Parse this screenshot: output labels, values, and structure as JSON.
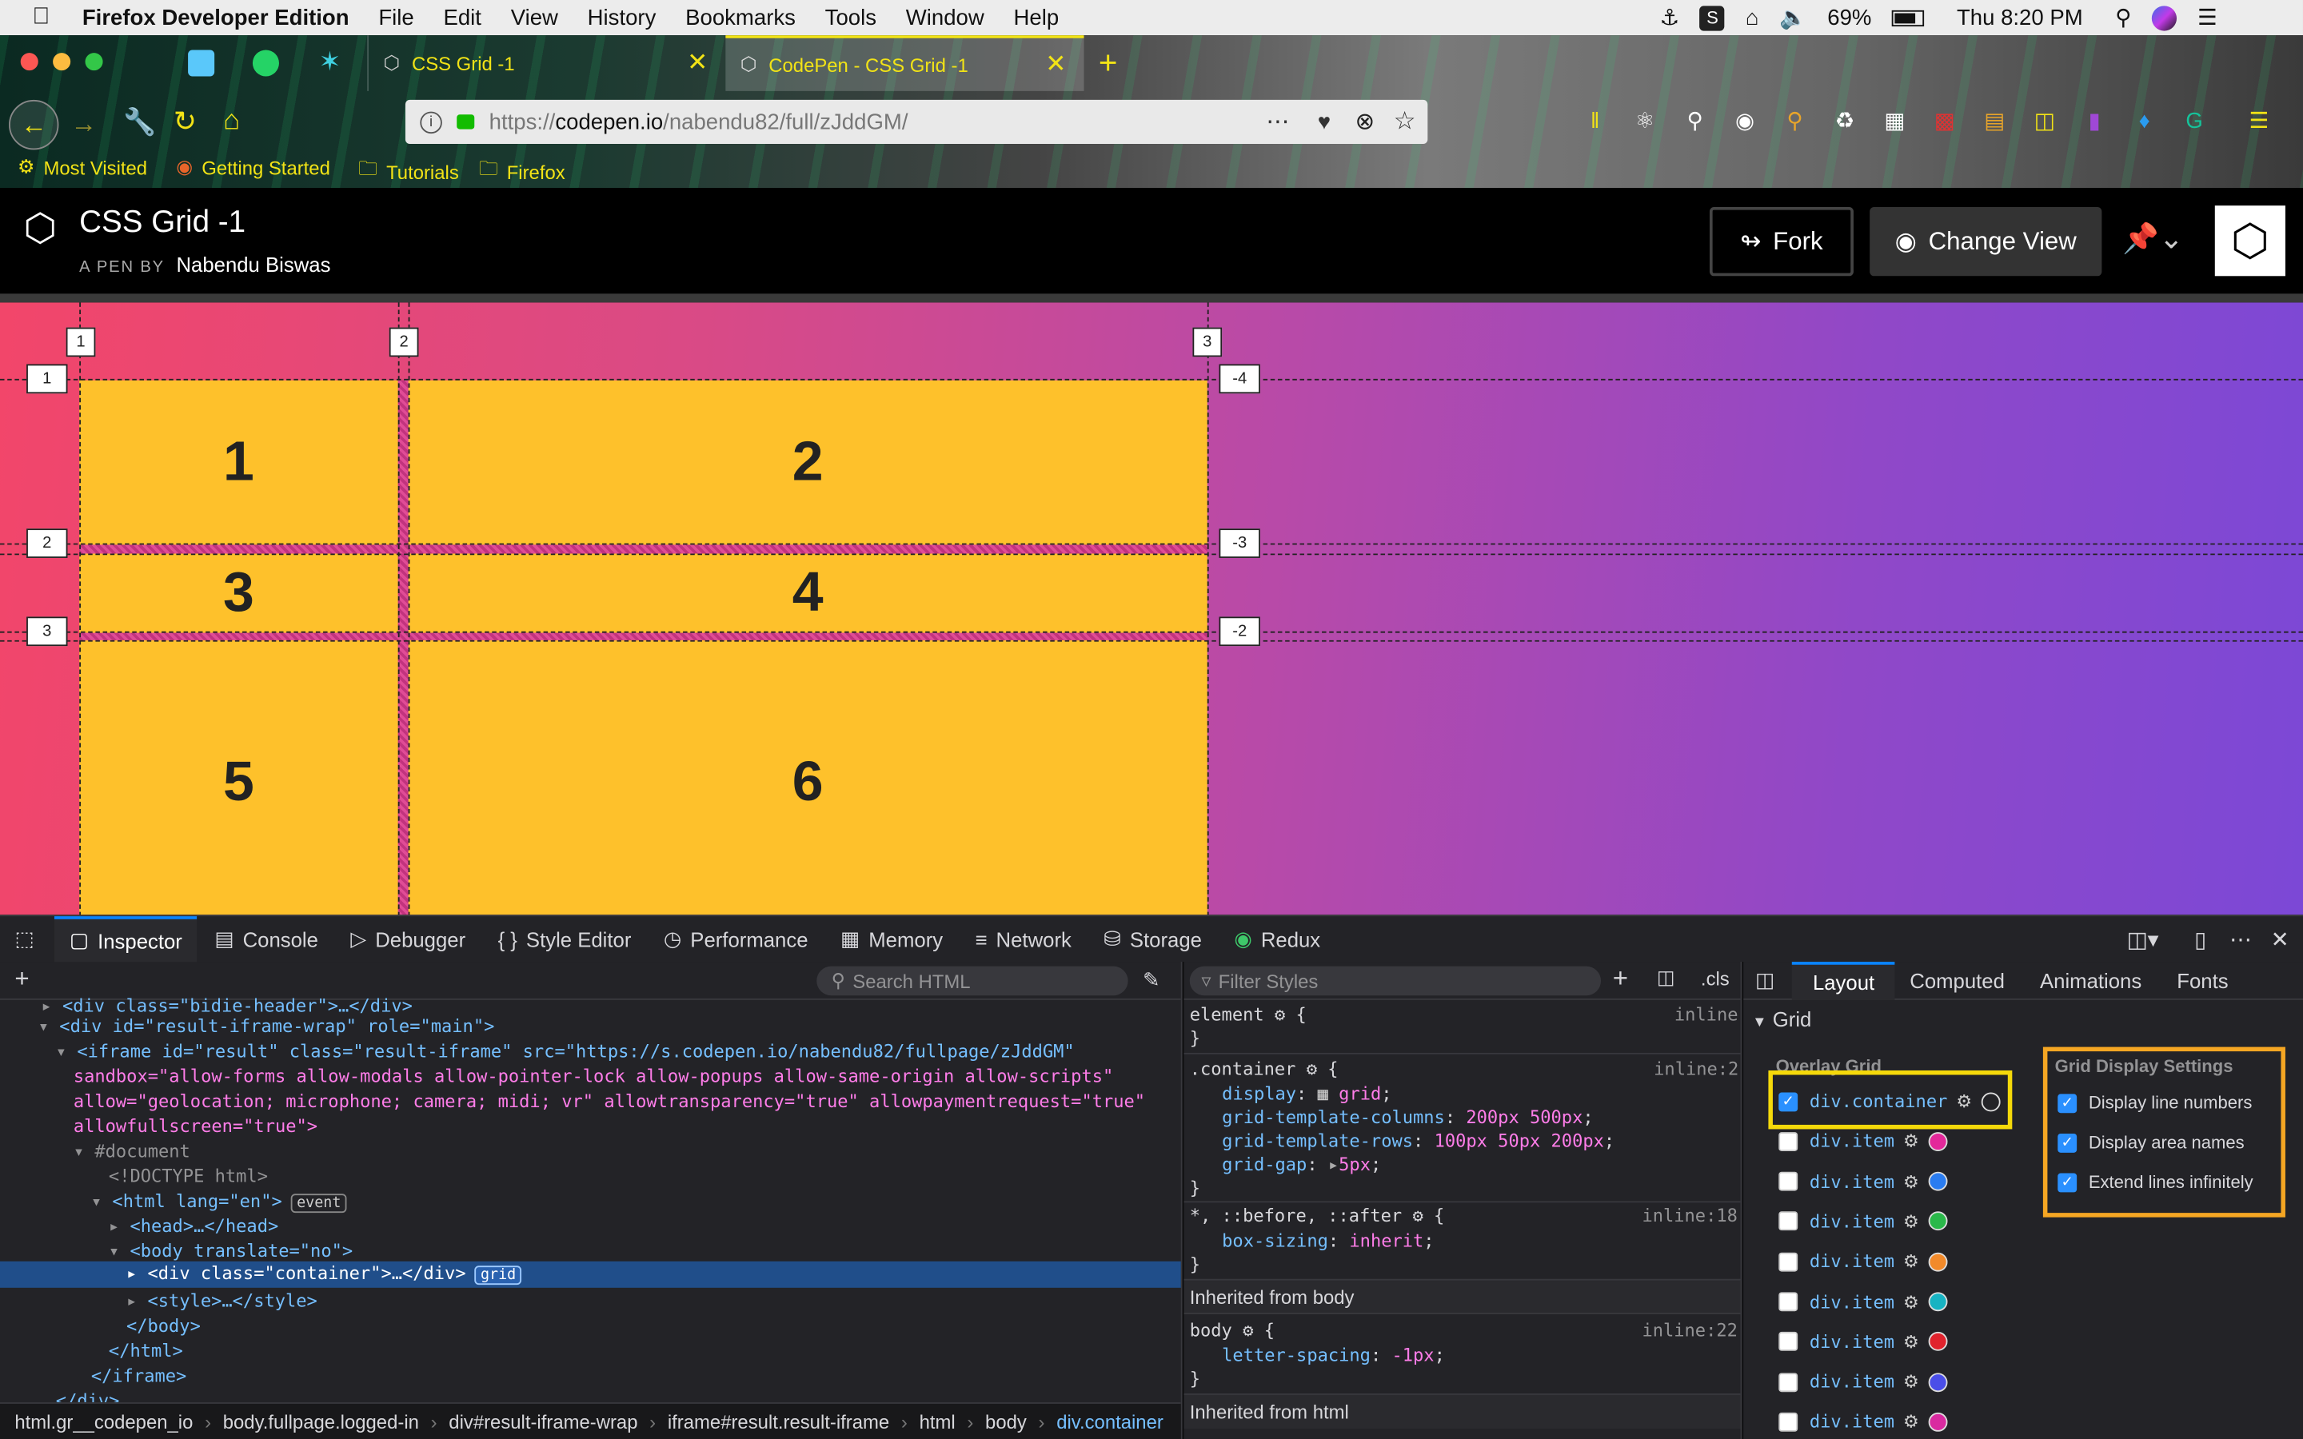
{
  "menubar": {
    "app": "Firefox Developer Edition",
    "items": [
      "File",
      "Edit",
      "View",
      "History",
      "Bookmarks",
      "Tools",
      "Window",
      "Help"
    ],
    "battery": "69%",
    "clock": "Thu 8:20 PM"
  },
  "tabs": [
    {
      "label": "CSS Grid -1"
    },
    {
      "label": "CodePen - CSS Grid -1"
    }
  ],
  "url": {
    "prefix": "https://",
    "host": "codepen.io",
    "path": "/nabendu82/full/zJddGM/"
  },
  "bookmarks": [
    "Most Visited",
    "Getting Started",
    "Tutorials",
    "Firefox"
  ],
  "codepen": {
    "title": "CSS Grid -1",
    "byline": "A PEN BY",
    "author": "Nabendu Biswas",
    "fork": "Fork",
    "change_view": "Change View"
  },
  "grid": {
    "col_lines": [
      "1",
      "2",
      "3"
    ],
    "row_lines_left": [
      "1",
      "2",
      "3"
    ],
    "row_lines_right": [
      "-4",
      "-3",
      "-2"
    ],
    "cells": [
      "1",
      "2",
      "3",
      "4",
      "5",
      "6"
    ]
  },
  "devtools": {
    "tabs": [
      "Inspector",
      "Console",
      "Debugger",
      "Style Editor",
      "Performance",
      "Memory",
      "Network",
      "Storage",
      "Redux"
    ],
    "search_html": "Search HTML",
    "filter_styles": "Filter Styles",
    "cls": ".cls",
    "side_tabs": [
      "Layout",
      "Computed",
      "Animations",
      "Fonts"
    ],
    "html_lines": [
      "<div class=\"bidie-header\">…</div>",
      "<div id=\"result-iframe-wrap\" role=\"main\">",
      "<iframe id=\"result\" class=\"result-iframe\" src=\"https://s.codepen.io/nabendu82/fullpage/zJddGM\"",
      "sandbox=\"allow-forms allow-modals allow-pointer-lock allow-popups allow-same-origin allow-scripts\"",
      "allow=\"geolocation; microphone; camera; midi; vr\" allowtransparency=\"true\" allowpaymentrequest=\"true\"",
      "allowfullscreen=\"true\">",
      "#document",
      "<!DOCTYPE html>",
      "<html lang=\"en\">",
      "<head>…</head>",
      "<body translate=\"no\">",
      "<div class=\"container\">…</div>",
      "<style>…</style>",
      "</body>",
      "</html>",
      "</iframe>",
      "</div>"
    ],
    "event_badge": "event",
    "grid_badge": "grid",
    "breadcrumbs": [
      "html.gr__codepen_io",
      "body.fullpage.logged-in",
      "div#result-iframe-wrap",
      "iframe#result.result-iframe",
      "html",
      "body",
      "div.container"
    ],
    "rules": [
      {
        "selector": "element",
        "source": "inline",
        "decls": []
      },
      {
        "selector": ".container",
        "source": "inline:2",
        "decls": [
          [
            "display",
            "grid"
          ],
          [
            "grid-template-columns",
            "200px 500px"
          ],
          [
            "grid-template-rows",
            "100px 50px 200px"
          ],
          [
            "grid-gap",
            "5px"
          ]
        ]
      },
      {
        "selector": "*, ::before, ::after",
        "source": "inline:18",
        "decls": [
          [
            "box-sizing",
            "inherit"
          ]
        ]
      },
      {
        "header": "Inherited from body"
      },
      {
        "selector": "body",
        "source": "inline:22",
        "decls": [
          [
            "letter-spacing",
            "-1px"
          ]
        ]
      },
      {
        "header": "Inherited from html"
      }
    ],
    "layout": {
      "section": "Grid",
      "overlay_title": "Overlay Grid",
      "overlays": [
        {
          "name": "div.container",
          "checked": true,
          "color": "#ffffff"
        },
        {
          "name": "div.item",
          "checked": false,
          "color": "#e3289a"
        },
        {
          "name": "div.item",
          "checked": false,
          "color": "#2a7cf0"
        },
        {
          "name": "div.item",
          "checked": false,
          "color": "#2ab84a"
        },
        {
          "name": "div.item",
          "checked": false,
          "color": "#f28a2a"
        },
        {
          "name": "div.item",
          "checked": false,
          "color": "#17b3c2"
        },
        {
          "name": "div.item",
          "checked": false,
          "color": "#e0232d"
        },
        {
          "name": "div.item",
          "checked": false,
          "color": "#4a4ee8"
        },
        {
          "name": "div.item",
          "checked": false,
          "color": "#d92aa0"
        }
      ],
      "settings_title": "Grid Display Settings",
      "settings": [
        "Display line numbers",
        "Display area names",
        "Extend lines infinitely"
      ]
    }
  }
}
